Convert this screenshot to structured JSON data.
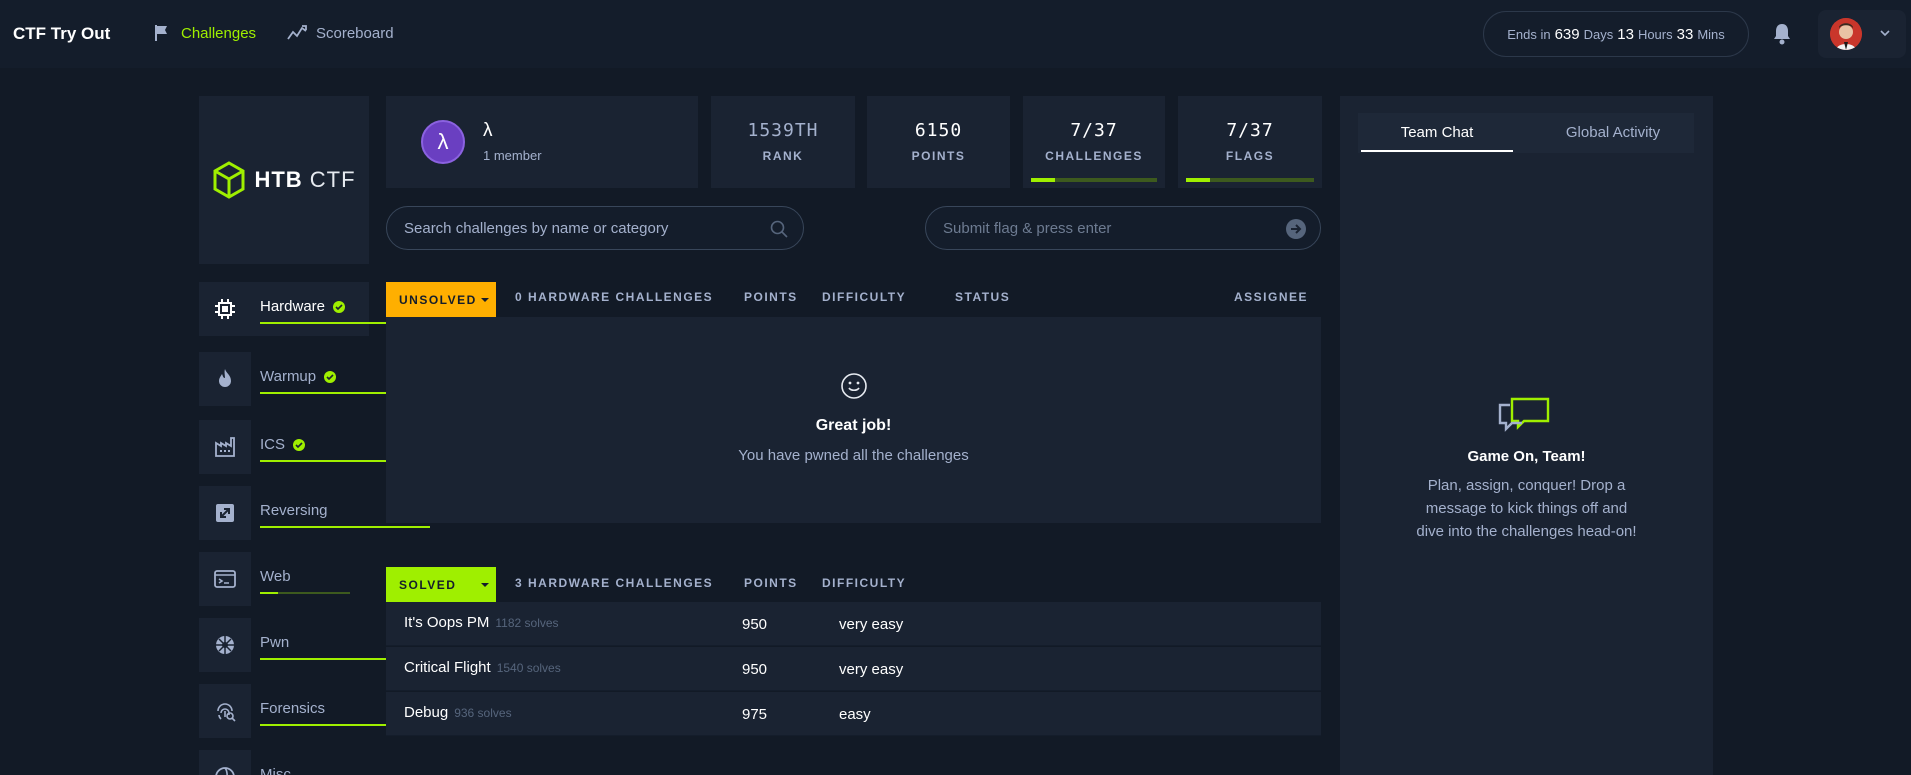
{
  "header": {
    "brand": "CTF Try Out",
    "nav": [
      {
        "label": "Challenges",
        "icon": "flag-icon",
        "active": true
      },
      {
        "label": "Scoreboard",
        "icon": "chart-line-icon",
        "active": false
      }
    ],
    "timer": {
      "prefix": "Ends in",
      "days": "639",
      "days_label": "Days",
      "hours": "13",
      "hours_label": "Hours",
      "mins": "33",
      "mins_label": "Mins"
    }
  },
  "logo": {
    "bold": "HTB",
    "light": "CTF"
  },
  "team": {
    "avatar_letter": "λ",
    "name": "λ",
    "members": "1 member"
  },
  "stats": {
    "rank": {
      "value": "1539TH",
      "label": "RANK"
    },
    "points": {
      "value": "6150",
      "label": "POINTS"
    },
    "challenges": {
      "value": "7/37",
      "label": "CHALLENGES",
      "progress": 0.19
    },
    "flags": {
      "value": "7/37",
      "label": "FLAGS",
      "progress": 0.19
    }
  },
  "search": {
    "placeholder": "Search challenges by name or category"
  },
  "flag_input": {
    "placeholder": "Submit flag & press enter"
  },
  "categories": [
    {
      "label": "Hardware",
      "icon": "chip-icon",
      "completed": true,
      "progress": 1.0
    },
    {
      "label": "Warmup",
      "icon": "flame-icon",
      "completed": true,
      "progress": 1.0
    },
    {
      "label": "ICS",
      "icon": "factory-icon",
      "completed": true,
      "progress": 1.0
    },
    {
      "label": "Reversing",
      "icon": "reverse-icon",
      "completed": false,
      "progress": 1.0
    },
    {
      "label": "Web",
      "icon": "browser-icon",
      "completed": false,
      "progress": 0.2
    },
    {
      "label": "Pwn",
      "icon": "bug-icon",
      "completed": false,
      "progress": 1.0
    },
    {
      "label": "Forensics",
      "icon": "fingerprint-icon",
      "completed": false,
      "progress": 1.0
    },
    {
      "label": "Misc",
      "icon": "misc-icon",
      "completed": false,
      "progress": 1.0
    }
  ],
  "unsolved": {
    "button": "UNSOLVED",
    "headers": {
      "count": "0 HARDWARE CHALLENGES",
      "points": "POINTS",
      "difficulty": "DIFFICULTY",
      "status": "STATUS",
      "assignee": "ASSIGNEE"
    },
    "empty_title": "Great job!",
    "empty_sub": "You have pwned all the challenges"
  },
  "solved": {
    "button": "SOLVED",
    "headers": {
      "count": "3 HARDWARE CHALLENGES",
      "points": "POINTS",
      "difficulty": "DIFFICULTY"
    },
    "rows": [
      {
        "name": "It's Oops PM",
        "solves": "1182 solves",
        "points": "950",
        "difficulty": "very easy"
      },
      {
        "name": "Critical Flight",
        "solves": "1540 solves",
        "points": "950",
        "difficulty": "very easy"
      },
      {
        "name": "Debug",
        "solves": "936 solves",
        "points": "975",
        "difficulty": "easy"
      }
    ]
  },
  "chat": {
    "tabs": [
      "Team Chat",
      "Global Activity"
    ],
    "title": "Game On, Team!",
    "message": "Plan, assign, conquer! Drop a message to kick things off and dive into the challenges head-on!"
  },
  "colors": {
    "accent": "#9fef00",
    "warning": "#ffaf00",
    "bg": "#121a26",
    "panel": "#1a2332"
  }
}
